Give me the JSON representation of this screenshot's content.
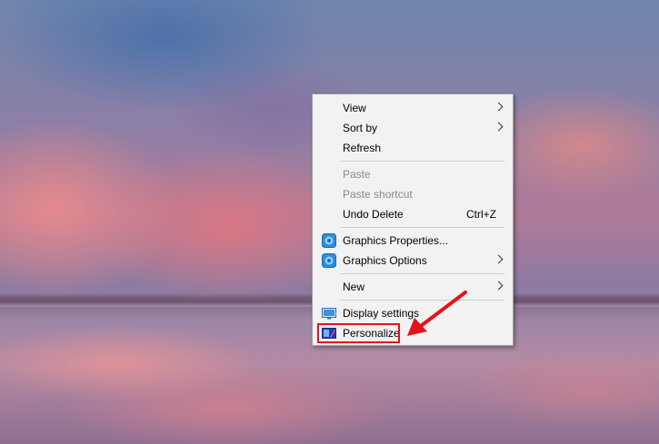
{
  "menu": {
    "items": [
      {
        "label": "View"
      },
      {
        "label": "Sort by"
      },
      {
        "label": "Refresh"
      },
      {
        "label": "Paste"
      },
      {
        "label": "Paste shortcut"
      },
      {
        "label": "Undo Delete",
        "shortcut": "Ctrl+Z"
      },
      {
        "label": "Graphics Properties..."
      },
      {
        "label": "Graphics Options"
      },
      {
        "label": "New"
      },
      {
        "label": "Display settings"
      },
      {
        "label": "Personalize"
      }
    ]
  },
  "colors": {
    "highlight": "#e8111a",
    "menu_background": "#f2f2f2",
    "disabled_text": "#8a8a8a"
  },
  "icons": {
    "graphics": "intel-graphics-icon",
    "display": "display-settings-icon",
    "personalize": "personalize-icon",
    "submenu": "chevron-right-icon"
  }
}
